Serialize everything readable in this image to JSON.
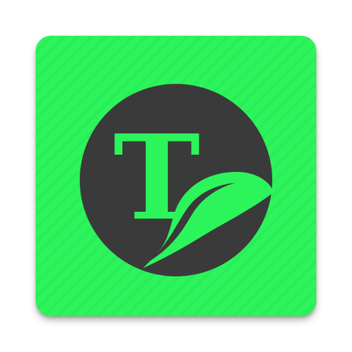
{
  "app_icon": {
    "glyph": "T",
    "colors": {
      "background": "#2cf55c",
      "stripe": "#26e052",
      "emblem": "#3a3a3a",
      "glyph": "#2cf55c"
    },
    "icons": [
      "circle-emblem-icon",
      "letter-t-icon",
      "leaf-icon"
    ]
  }
}
